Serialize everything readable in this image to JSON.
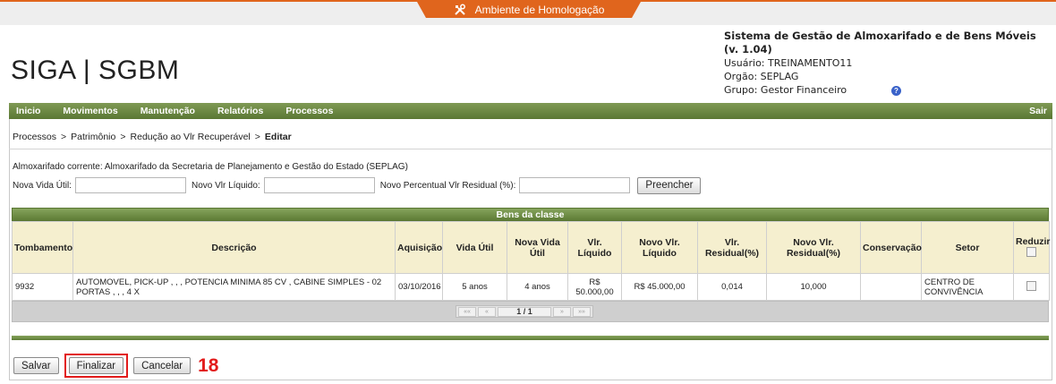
{
  "env": {
    "label": "Ambiente de Homologação"
  },
  "header": {
    "logo": "SIGA | SGBM",
    "system_title": "Sistema de Gestão de Almoxarifado e de Bens Móveis (v. 1.04)",
    "user": "Usuário: TREINAMENTO11",
    "org": "Orgão: SEPLAG",
    "group": "Grupo: Gestor Financeiro",
    "help_icon": "help-icon"
  },
  "nav": {
    "items": [
      "Inicio",
      "Movimentos",
      "Manutenção",
      "Relatórios",
      "Processos"
    ],
    "exit": "Sair"
  },
  "breadcrumb": [
    "Processos",
    "Patrimônio",
    "Redução ao Vlr Recuperável",
    "Editar"
  ],
  "breadcrumb_sep": ">",
  "almoxarifado": "Almoxarifado corrente: Almoxarifado da Secretaria de Planejamento e Gestão do Estado (SEPLAG)",
  "form": {
    "nova_vida_label": "Nova Vida Útil:",
    "nova_vida_value": "",
    "novo_vlr_label": "Novo Vlr Líquido:",
    "novo_vlr_value": "",
    "novo_pct_label": "Novo Percentual Vlr Residual (%):",
    "novo_pct_value": "",
    "fill_button": "Preencher"
  },
  "table": {
    "caption": "Bens da classe",
    "headers": [
      "Tombamento",
      "Descrição",
      "Aquisição",
      "Vida Útil",
      "Nova Vida Útil",
      "Vlr. Líquido",
      "Novo Vlr. Líquido",
      "Vlr. Residual(%)",
      "Novo Vlr. Residual(%)",
      "Conservação",
      "Setor",
      "Reduzir"
    ],
    "rows": [
      [
        "9932",
        "AUTOMOVEL, PICK-UP , , , POTENCIA MINIMA 85 CV , CABINE SIMPLES - 02 PORTAS , , , 4 X",
        "03/10/2016",
        "5 anos",
        "4 anos",
        "R$ 50.000,00",
        "R$ 45.000,00",
        "0,014",
        "10,000",
        "",
        "CENTRO DE CONVIVÊNCIA",
        ""
      ]
    ],
    "pager": {
      "first": "««",
      "prev": "«",
      "page": "1 / 1",
      "next": "»",
      "last": "»»"
    }
  },
  "actions": {
    "save": "Salvar",
    "finalize": "Finalizar",
    "cancel": "Cancelar",
    "step": "18"
  },
  "colors": {
    "accent": "#e0651d",
    "nav": "#5a7733",
    "header_bg": "#f5efcf",
    "highlight": "#e21b1b"
  }
}
